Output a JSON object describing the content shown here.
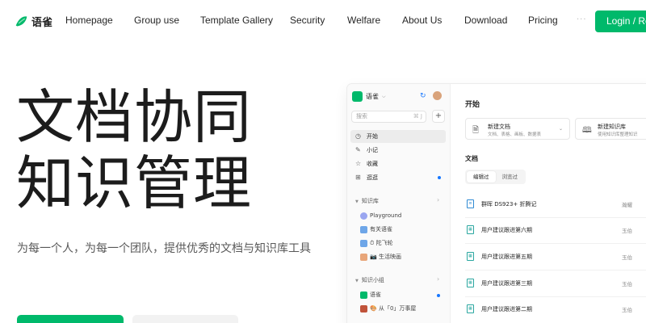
{
  "nav": {
    "logo_text": "语雀",
    "items": [
      "Homepage",
      "Group use",
      "Template Gallery",
      "Security",
      "Welfare",
      "About Us",
      "Download",
      "Pricing"
    ],
    "more": "···",
    "login": "Login / Re"
  },
  "hero": {
    "title_line1": "文档协同",
    "title_line2": "知识管理",
    "subtitle": "为每一个人，为每一个团队，提供优秀的文档与知识库工具"
  },
  "preview": {
    "brand": "语雀",
    "search_placeholder": "搜索",
    "search_shortcut": "⌘ J",
    "add": "+",
    "sidebar": {
      "items": [
        {
          "label": "开始",
          "icon": "clock-icon"
        },
        {
          "label": "小记",
          "icon": "feather-icon"
        },
        {
          "label": "收藏",
          "icon": "star-icon"
        },
        {
          "label": "逛逛",
          "icon": "grid-icon"
        }
      ],
      "knowledge_group": "知识库",
      "books": [
        "Playground",
        "有关语雀",
        "⏱ 陀飞轮",
        "📷 生活映画"
      ],
      "team_group": "知识小组",
      "teams": [
        "语雀",
        "🎨 从「0」万事屋"
      ]
    },
    "main": {
      "start_title": "开始",
      "cards": [
        {
          "title": "新建文档",
          "desc": "文档、表格、画板、数据表"
        },
        {
          "title": "新建知识库",
          "desc": "使用知识库整理知识"
        }
      ],
      "docs_title": "文档",
      "tabs": [
        "编辑过",
        "浏览过"
      ],
      "docs": [
        {
          "title": "群晖 DS923+ 折腾记",
          "meta": "瀚耀"
        },
        {
          "title": "用户建议跟进第六期",
          "meta": "玉伯"
        },
        {
          "title": "用户建议跟进第五期",
          "meta": "玉伯"
        },
        {
          "title": "用户建议跟进第三期",
          "meta": "玉伯"
        },
        {
          "title": "用户建议跟进第二期",
          "meta": "玉伯"
        }
      ]
    }
  },
  "colors": {
    "brand": "#00b96b",
    "accent_blue": "#1677ff"
  }
}
